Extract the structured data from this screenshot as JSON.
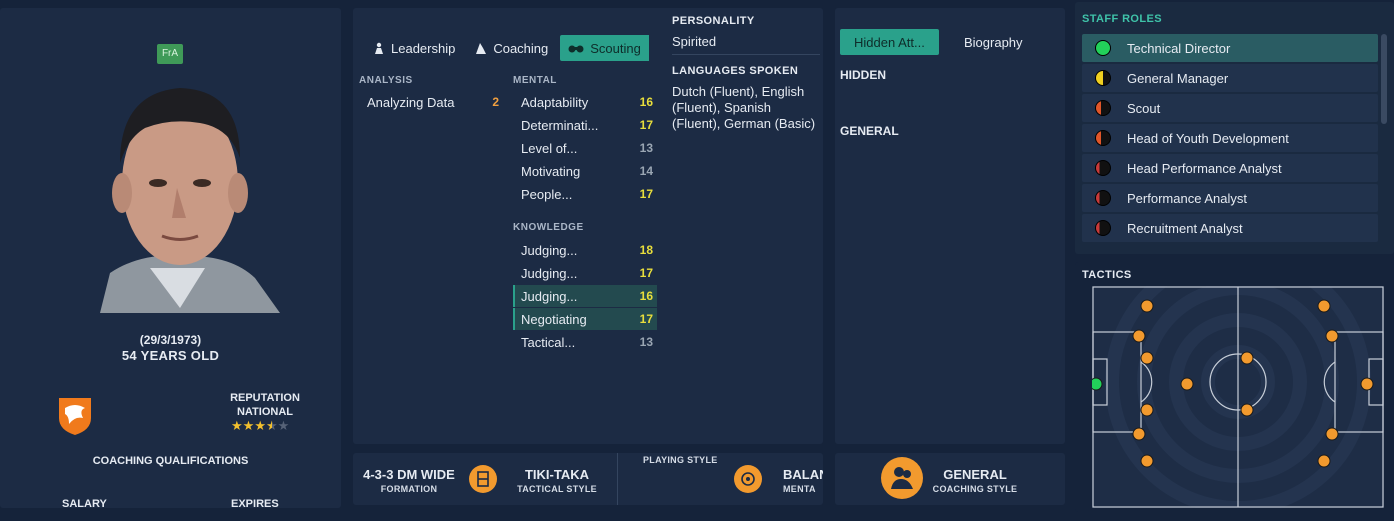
{
  "profile": {
    "nationality_code": "FrA",
    "dob": "(29/3/1973)",
    "age": "54 YEARS OLD",
    "reputation_label": "REPUTATION",
    "reputation_level": "NATIONAL",
    "reputation_stars": 3.5,
    "reputation_max": 5,
    "coaching_qualifications_label": "COACHING QUALIFICATIONS",
    "salary_label": "SALARY",
    "expires_label": "EXPIRES"
  },
  "attributes": {
    "tabs": [
      {
        "label": "Leadership",
        "icon": "leadership-icon"
      },
      {
        "label": "Coaching",
        "icon": "coaching-icon"
      },
      {
        "label": "Scouting",
        "icon": "binoculars-icon",
        "active": true
      }
    ],
    "analysis_header": "ANALYSIS",
    "analysis": [
      {
        "label": "Analyzing Data",
        "value": "2"
      }
    ],
    "mental_header": "MENTAL",
    "mental": [
      {
        "label": "Adaptability",
        "value": "16"
      },
      {
        "label": "Determinati...",
        "value": "17"
      },
      {
        "label": "Level of...",
        "value": "13"
      },
      {
        "label": "Motivating",
        "value": "14"
      },
      {
        "label": "People...",
        "value": "17"
      }
    ],
    "knowledge_header": "KNOWLEDGE",
    "knowledge": [
      {
        "label": "Judging...",
        "value": "18"
      },
      {
        "label": "Judging...",
        "value": "17"
      },
      {
        "label": "Judging...",
        "value": "16"
      },
      {
        "label": "Negotiating",
        "value": "17"
      },
      {
        "label": "Tactical...",
        "value": "13"
      }
    ],
    "personality_header": "PERSONALITY",
    "personality": "Spirited",
    "languages_header": "LANGUAGES SPOKEN",
    "languages": "Dutch (Fluent), English (Fluent), Spanish (Fluent), German (Basic)"
  },
  "strip": {
    "formation": "4-3-3 DM WIDE",
    "formation_label": "FORMATION",
    "tactical_style": "TIKI-TAKA",
    "tactical_style_label": "TACTICAL STYLE",
    "playing_style_header": "PLAYING STYLE",
    "playing_style": "BALAN",
    "playing_style_label": "MENTA"
  },
  "hidden": {
    "tabs": [
      {
        "label": "Hidden Att...",
        "active": true
      },
      {
        "label": "Biography"
      }
    ],
    "hidden_header": "HIDDEN",
    "general_header": "GENERAL"
  },
  "coaching_style": {
    "value": "GENERAL",
    "label": "COACHING STYLE"
  },
  "staff_roles": {
    "title": "STAFF ROLES",
    "roles": [
      {
        "label": "Technical Director",
        "suitability": "high",
        "color": "#22d15a"
      },
      {
        "label": "General Manager",
        "suitability": "medium",
        "color": "#f0d020"
      },
      {
        "label": "Scout",
        "suitability": "low",
        "color": "#e0562a"
      },
      {
        "label": "Head of Youth Development",
        "suitability": "low",
        "color": "#e0562a"
      },
      {
        "label": "Head Performance Analyst",
        "suitability": "very-low",
        "color": "#c83a3a"
      },
      {
        "label": "Performance Analyst",
        "suitability": "very-low",
        "color": "#c83a3a"
      },
      {
        "label": "Recruitment Analyst",
        "suitability": "very-low",
        "color": "#c83a3a"
      }
    ]
  },
  "tactics": {
    "title": "TACTICS"
  },
  "colors": {
    "accent": "#2aa18b",
    "orange": "#f29a2e",
    "panel": "#1c2b44"
  }
}
